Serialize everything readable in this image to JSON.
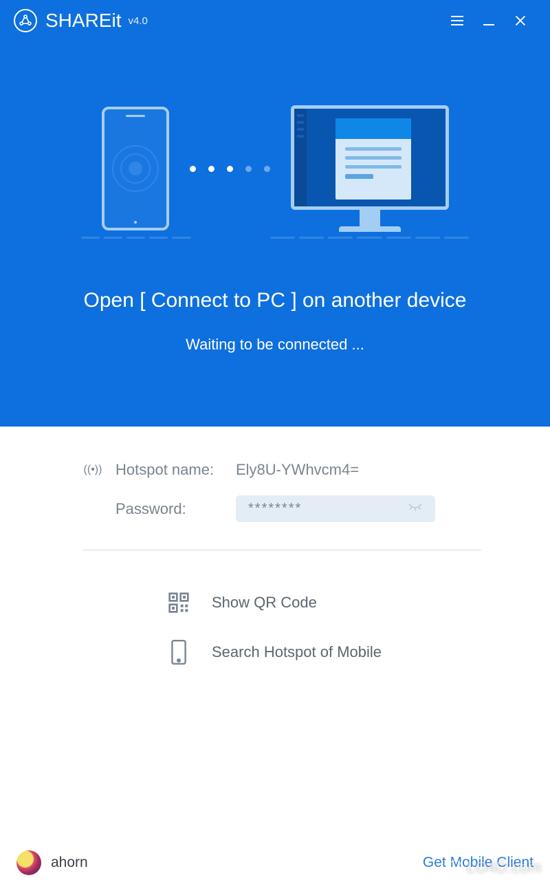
{
  "app": {
    "name": "SHAREit",
    "version": "v4.0"
  },
  "hero": {
    "title": "Open [ Connect to PC ] on another device",
    "subtitle": "Waiting to be connected ..."
  },
  "hotspot": {
    "label": "Hotspot name:",
    "value": "Ely8U-YWhvcm4="
  },
  "password": {
    "label": "Password:",
    "value": "********"
  },
  "actions": {
    "qr": "Show QR Code",
    "search": "Search Hotspot of Mobile"
  },
  "footer": {
    "username": "ahorn",
    "get_client": "Get Mobile Client"
  },
  "watermark": "LO4D.com"
}
